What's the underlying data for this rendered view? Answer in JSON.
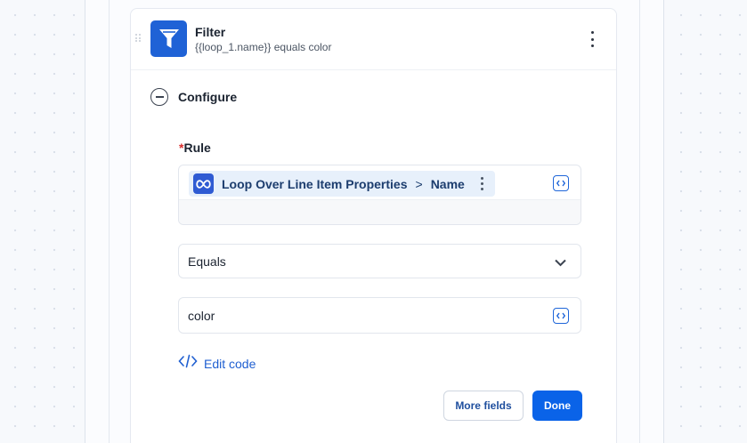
{
  "step": {
    "title": "Filter",
    "subtitle": "{{loop_1.name}} equals color",
    "icon": "filter-funnel-icon",
    "icon_color": "#1f62d6"
  },
  "configure": {
    "label": "Configure",
    "expanded": true
  },
  "rule": {
    "label": "Rule",
    "required_marker": "*",
    "token": {
      "source": "Loop Over Line Item Properties",
      "separator": ">",
      "field": "Name"
    }
  },
  "operator": {
    "selected": "Equals"
  },
  "value": {
    "text": "color"
  },
  "edit_code": {
    "label": "Edit code"
  },
  "actions": {
    "more_fields": "More fields",
    "done": "Done"
  },
  "colors": {
    "accent": "#0a63e8",
    "link": "#1f5fd1",
    "required": "#d92d2d",
    "token_bg": "#e7f0fb"
  }
}
